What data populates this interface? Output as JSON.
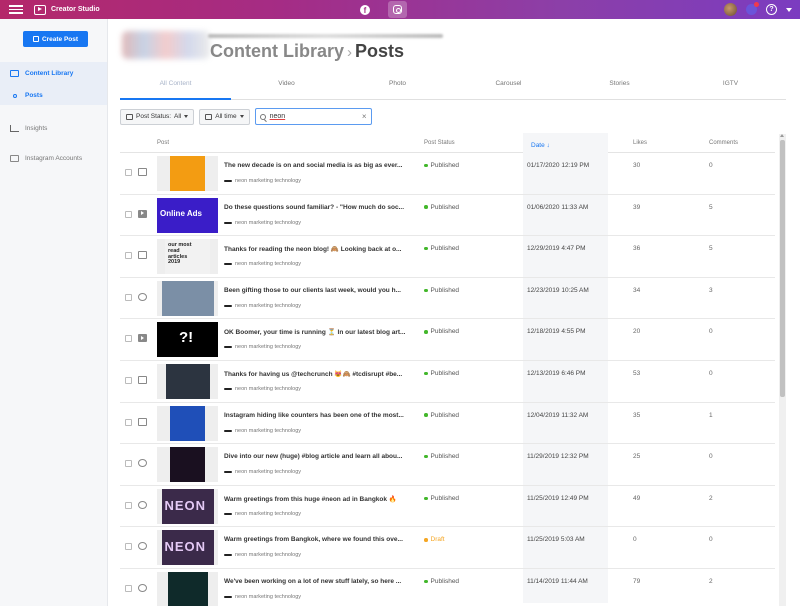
{
  "topbar": {
    "app_title": "Creator Studio",
    "facebook_label": "f",
    "help_label": "?"
  },
  "sidebar": {
    "create_post": "Create Post",
    "items": [
      {
        "label": "Content Library"
      },
      {
        "label": "Posts"
      },
      {
        "label": "Insights"
      },
      {
        "label": "Instagram Accounts"
      }
    ]
  },
  "header": {
    "title": "Content Library",
    "separator": "›",
    "current": "Posts"
  },
  "tabs": [
    "All Content",
    "Video",
    "Photo",
    "Carousel",
    "Stories",
    "IGTV"
  ],
  "filters": {
    "status_label": "Post Status:",
    "status_value": "All",
    "time_label": "All time",
    "search_value": "neon",
    "clear_label": "×"
  },
  "table": {
    "columns": {
      "post": "Post",
      "status": "Post Status",
      "date": "Date ↓",
      "likes": "Likes",
      "comments": "Comments"
    },
    "account_name": "neon marketing technology",
    "status_colors": {
      "Published": "#42b72a",
      "Draft": "#f5a623"
    },
    "rows": [
      {
        "text": "The new decade is on and social media is as big as ever...",
        "status": "Published",
        "date": "01/17/2020 12:19 PM",
        "likes": "30",
        "comments": "0",
        "type": "photo",
        "thumb_bg": "#f39c12",
        "thumb_text": ""
      },
      {
        "text": "Do these questions sound familiar? - \"How much do soc...",
        "status": "Published",
        "date": "01/06/2020 11:33 AM",
        "likes": "39",
        "comments": "5",
        "type": "video",
        "thumb_bg": "#3a1dc8",
        "thumb_text": "Online Ads"
      },
      {
        "text": "Thanks for reading the neon blog! 🙈 Looking back at o...",
        "status": "Published",
        "date": "12/29/2019 4:47 PM",
        "likes": "36",
        "comments": "5",
        "type": "photo",
        "thumb_bg": "#f2f2f2",
        "thumb_text": "our most read articles 2019"
      },
      {
        "text": "Been gifting those to our clients last week, would you h...",
        "status": "Published",
        "date": "12/23/2019 10:25 AM",
        "likes": "34",
        "comments": "3",
        "type": "carousel",
        "thumb_bg": "#7b8fa6",
        "thumb_text": ""
      },
      {
        "text": "OK Boomer, your time is running ⏳ In our latest blog art...",
        "status": "Published",
        "date": "12/18/2019 4:55 PM",
        "likes": "20",
        "comments": "0",
        "type": "video",
        "thumb_bg": "#000000",
        "thumb_text": "?!"
      },
      {
        "text": "Thanks for having us @techcrunch 😻🙈 #tcdisrupt #be...",
        "status": "Published",
        "date": "12/13/2019 6:46 PM",
        "likes": "53",
        "comments": "0",
        "type": "photo",
        "thumb_bg": "#2c3440",
        "thumb_text": ""
      },
      {
        "text": "Instagram hiding like counters has been one of the most...",
        "status": "Published",
        "date": "12/04/2019 11:32 AM",
        "likes": "35",
        "comments": "1",
        "type": "photo",
        "thumb_bg": "#1f4fb8",
        "thumb_text": ""
      },
      {
        "text": "Dive into our new (huge) #blog article and learn all abou...",
        "status": "Published",
        "date": "11/29/2019 12:32 PM",
        "likes": "25",
        "comments": "0",
        "type": "carousel",
        "thumb_bg": "#1a1020",
        "thumb_text": ""
      },
      {
        "text": "Warm greetings from this huge #neon ad in Bangkok 🔥",
        "status": "Published",
        "date": "11/25/2019 12:49 PM",
        "likes": "49",
        "comments": "2",
        "type": "carousel",
        "thumb_bg": "#3b2a4a",
        "thumb_text": "NEON"
      },
      {
        "text": "Warm greetings from Bangkok, where we found this ove...",
        "status": "Draft",
        "date": "11/25/2019 5:03 AM",
        "likes": "0",
        "comments": "0",
        "type": "carousel",
        "thumb_bg": "#3b2a4a",
        "thumb_text": "NEON"
      },
      {
        "text": "We've been working on a lot of new stuff lately, so here ...",
        "status": "Published",
        "date": "11/14/2019 11:44 AM",
        "likes": "79",
        "comments": "2",
        "type": "carousel",
        "thumb_bg": "#0f2a2a",
        "thumb_text": ""
      }
    ]
  }
}
